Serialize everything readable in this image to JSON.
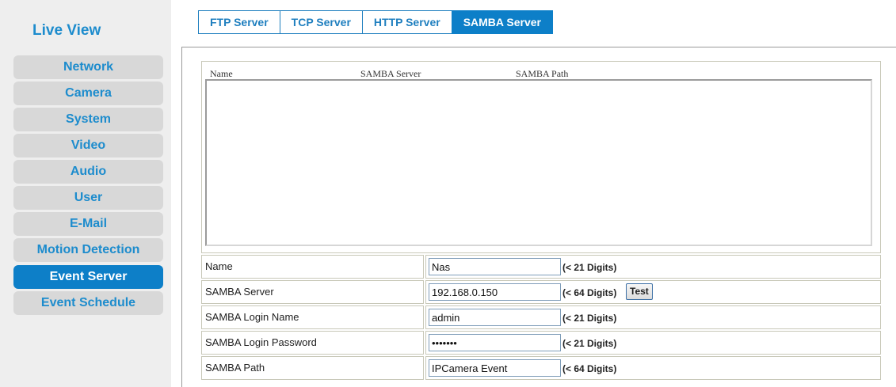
{
  "sidebar": {
    "title": "Live View",
    "items": [
      {
        "label": "Network"
      },
      {
        "label": "Camera"
      },
      {
        "label": "System"
      },
      {
        "label": "Video"
      },
      {
        "label": "Audio"
      },
      {
        "label": "User"
      },
      {
        "label": "E-Mail"
      },
      {
        "label": "Motion Detection"
      },
      {
        "label": "Event Server",
        "active": true
      },
      {
        "label": "Event Schedule"
      }
    ]
  },
  "tabs": [
    {
      "label": "FTP Server"
    },
    {
      "label": "TCP Server"
    },
    {
      "label": "HTTP Server"
    },
    {
      "label": "SAMBA Server",
      "active": true
    }
  ],
  "list": {
    "columns": [
      "Name",
      "SAMBA Server",
      "SAMBA Path"
    ]
  },
  "form": {
    "name": {
      "label": "Name",
      "value": "Nas",
      "hint": "(< 21 Digits)"
    },
    "server": {
      "label": "SAMBA Server",
      "value": "192.168.0.150",
      "hint": "(< 64 Digits)",
      "test_label": "Test"
    },
    "login_name": {
      "label": "SAMBA Login Name",
      "value": "admin",
      "hint": "(< 21 Digits)"
    },
    "login_password": {
      "label": "SAMBA Login Password",
      "value": "1234567",
      "hint": "(< 21 Digits)"
    },
    "path": {
      "label": "SAMBA Path",
      "value": "IPCamera Event",
      "hint": "(< 64 Digits)"
    }
  },
  "colors": {
    "accent": "#0d7fc8",
    "link": "#1d8ccd",
    "sidebar_bg": "#eeeeee"
  }
}
